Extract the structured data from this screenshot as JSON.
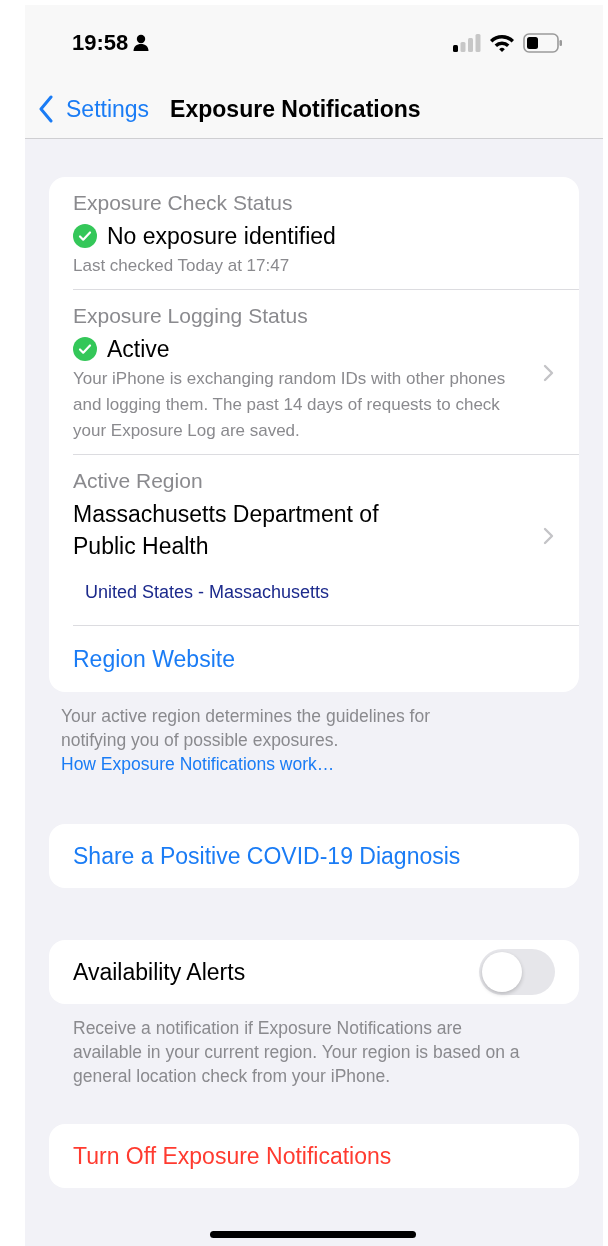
{
  "status_bar": {
    "time": "19:58"
  },
  "nav": {
    "back": "Settings",
    "title": "Exposure Notifications"
  },
  "status_card": {
    "rows": [
      {
        "kind": "status",
        "label": "Exposure Check Status",
        "value": "No exposure identified",
        "detail": "Last checked Today at 17:47",
        "disclosure": false
      },
      {
        "kind": "status",
        "label": "Exposure Logging Status",
        "value": "Active",
        "detail": "Your iPhone is exchanging random IDs with other phones and logging them. The past 14 days of requests to check your Exposure Log are saved.",
        "disclosure": true
      },
      {
        "kind": "region",
        "label": "Active Region",
        "value": "Massachusetts Department of Public Health",
        "detail": "United States - Massachusetts",
        "disclosure": true
      },
      {
        "kind": "link",
        "value": "Region Website",
        "disclosure": false
      }
    ],
    "footer": {
      "text": "Your active region determines the guidelines for notifying you of possible exposures.",
      "link": "How Exposure Notifications work…"
    }
  },
  "share_button": "Share a Positive COVID-19 Diagnosis",
  "alerts": {
    "label": "Availability Alerts",
    "on": false,
    "footer": "Receive a notification if Exposure Notifications are available in your current region. Your region is based on a general location check from your iPhone."
  },
  "turn_off_button": "Turn Off Exposure Notifications"
}
